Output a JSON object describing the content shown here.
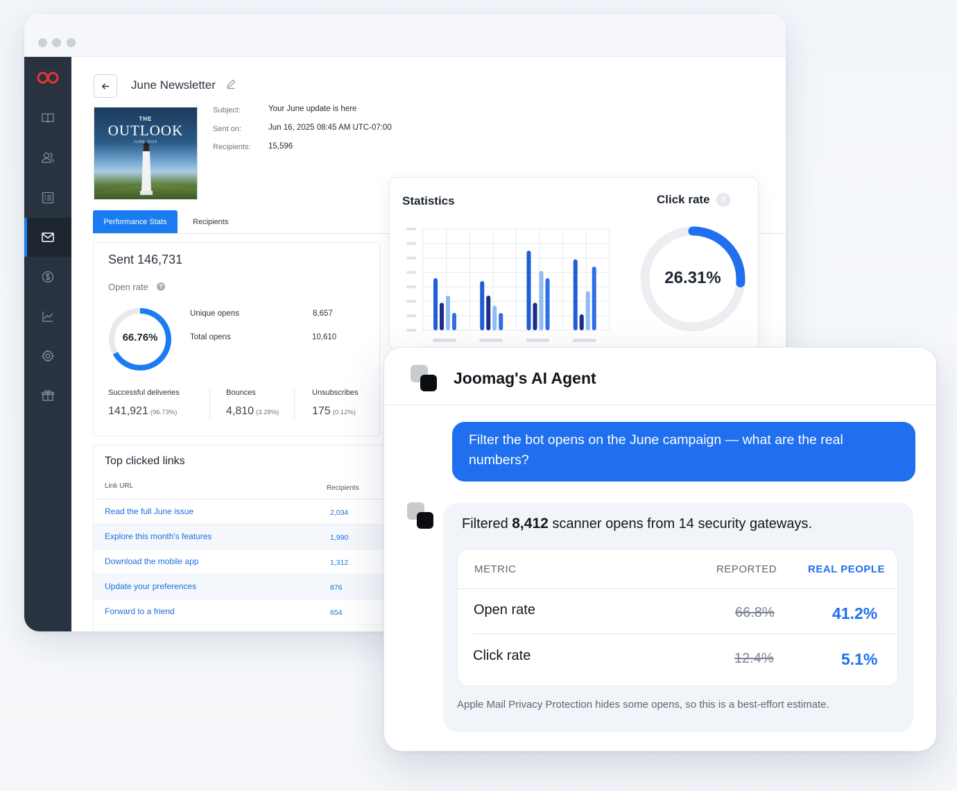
{
  "app": {
    "newsletter_title": "June Newsletter",
    "cover": {
      "the": "THE",
      "title": "OUTLOOK",
      "date": "JUNE 2025"
    },
    "meta": {
      "subject_label": "Subject:",
      "subject_value": "Your June update is here",
      "sent_label": "Sent on:",
      "sent_value": "Jun 16, 2025 08:45 AM UTC-07:00",
      "recipients_label": "Recipients:",
      "recipients_value": "15,596"
    },
    "tabs": [
      "Performance Stats",
      "Recipients"
    ],
    "stats": {
      "sent": "Sent 146,731",
      "open_rate_label": "Open rate",
      "open_rate_value": "66.76%",
      "open_rate_fraction": 0.6676,
      "unique_opens_label": "Unique opens",
      "unique_opens_value": "8,657",
      "total_opens_label": "Total opens",
      "total_opens_value": "10,610",
      "deliveries_label": "Successful deliveries",
      "deliveries_value": "141,921",
      "deliveries_pct": "(96.73%)",
      "bounces_label": "Bounces",
      "bounces_value": "4,810",
      "bounces_pct": "(3.28%)",
      "unsubs_label": "Unsubscribes",
      "unsubs_value": "175",
      "unsubs_pct": "(0.12%)"
    },
    "links": {
      "title": "Top clicked links",
      "col_url": "Link URL",
      "col_recipients": "Recipients",
      "rows": [
        {
          "text": "Read the full June issue",
          "count": "2,034"
        },
        {
          "text": "Explore this month's features",
          "count": "1,990"
        },
        {
          "text": "Download the mobile app",
          "count": "1,312"
        },
        {
          "text": "Update your preferences",
          "count": "876"
        },
        {
          "text": "Forward to a friend",
          "count": "654"
        }
      ]
    }
  },
  "statistics": {
    "title": "Statistics",
    "click_rate_label": "Click rate",
    "click_rate_value": "26.31%",
    "click_rate_fraction": 0.2631
  },
  "chart_data": {
    "type": "bar",
    "title": "Statistics",
    "xlabel": "",
    "ylabel": "",
    "categories": [
      "",
      "",
      "",
      ""
    ],
    "ylim": [
      0,
      7
    ],
    "grid": true,
    "series": [
      {
        "color": "#1f5ed6",
        "values": [
          3.6,
          3.4,
          5.5,
          4.9
        ]
      },
      {
        "color": "#1a2e8a",
        "values": [
          1.9,
          2.4,
          1.9,
          1.1
        ]
      },
      {
        "color": "#8fbcf2",
        "values": [
          2.4,
          1.7,
          4.1,
          2.7
        ]
      },
      {
        "color": "#2f6ee6",
        "values": [
          1.2,
          1.2,
          3.6,
          4.4
        ]
      }
    ]
  },
  "agent": {
    "title": "Joomag's AI Agent",
    "user_message": "Filter the bot opens on the June campaign — what are the real numbers?",
    "reply_prefix": "Filtered ",
    "reply_bold": "8,412",
    "reply_suffix": " scanner opens from 14 security gateways.",
    "table": {
      "h_metric": "METRIC",
      "h_reported": "REPORTED",
      "h_real": "REAL PEOPLE",
      "rows": [
        {
          "metric": "Open rate",
          "reported": "66.8%",
          "real": "41.2%"
        },
        {
          "metric": "Click rate",
          "reported": "12.4%",
          "real": "5.1%"
        }
      ]
    },
    "footnote": "Apple Mail Privacy Protection hides some opens, so this is a best-effort estimate."
  },
  "colors": {
    "accent": "#1a7cf0",
    "agent_blue": "#1f6fee",
    "sidebar": "#28333f",
    "brand_red": "#e8352b"
  },
  "icons": [
    "logo-icon",
    "book-icon",
    "users-icon",
    "list-icon",
    "mail-icon",
    "dollar-icon",
    "chart-icon",
    "gear-icon",
    "gift-icon"
  ]
}
